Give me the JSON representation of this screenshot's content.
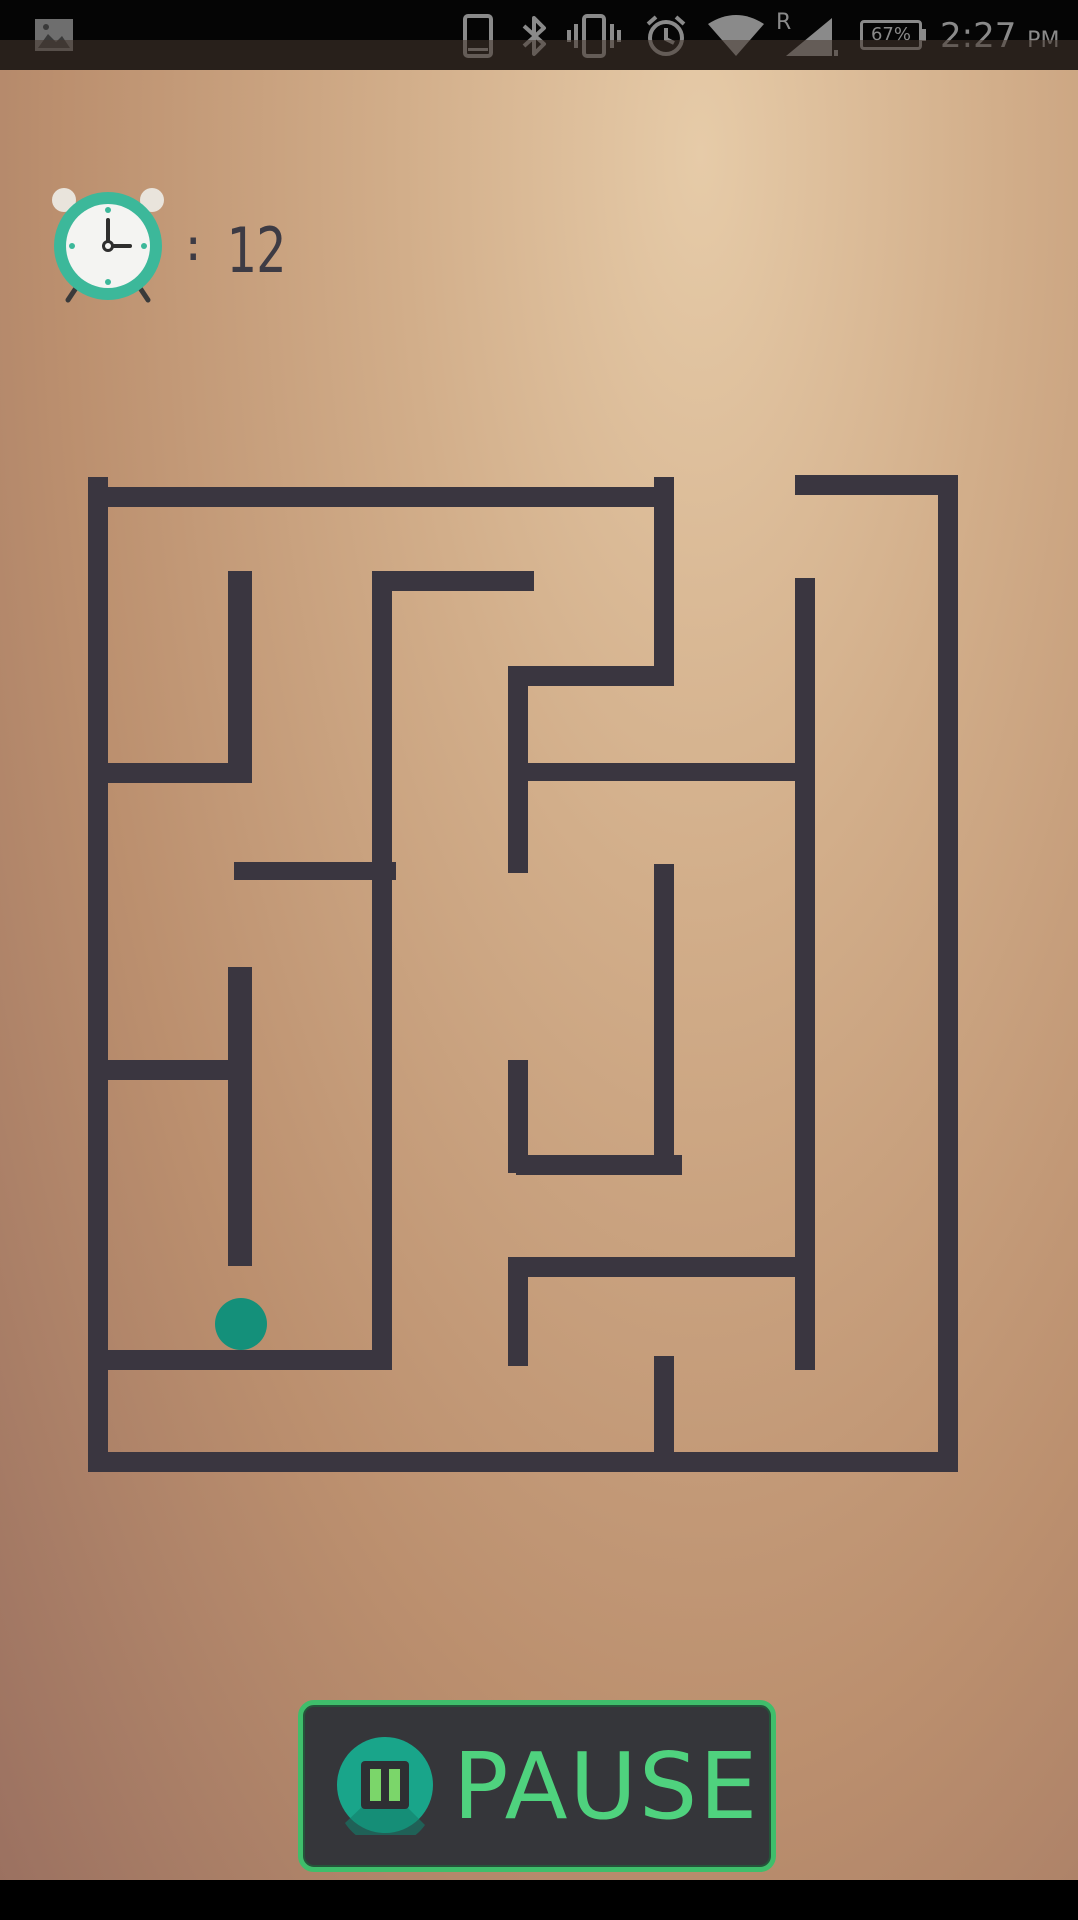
{
  "status_bar": {
    "icons": [
      "gallery-icon",
      "phone-icon",
      "bluetooth-icon",
      "vibrate-icon",
      "alarm-icon",
      "wifi-icon",
      "signal-icon",
      "battery-icon"
    ],
    "signal_roaming": "R",
    "battery_percent": "67%",
    "time": "2:27",
    "ampm": "PM",
    "icon_color": "#8a8a8a"
  },
  "timer": {
    "icon": "alarm-clock-icon",
    "separator": ":",
    "seconds": "12",
    "text_color": "#3d3b44"
  },
  "maze": {
    "wall_color": "#3a3640",
    "ball_color": "#14907a"
  },
  "pause_button": {
    "label": "PAUSE",
    "icon": "pause-icon",
    "border_color": "#3fbe6b",
    "label_color": "#4fd27e",
    "background": "#35363a"
  }
}
